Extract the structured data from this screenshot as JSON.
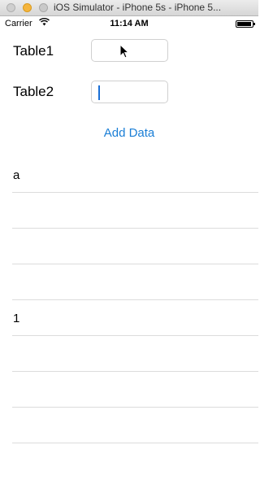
{
  "window": {
    "title": "iOS Simulator - iPhone 5s - iPhone 5..."
  },
  "status_bar": {
    "carrier": "Carrier",
    "time": "11:14 AM"
  },
  "form": {
    "table1_label": "Table1",
    "table1_value": "",
    "table2_label": "Table2",
    "table2_value": "",
    "add_button_label": "Add Data"
  },
  "table": {
    "rows": [
      "a",
      "",
      "",
      "",
      "1",
      "",
      "",
      ""
    ]
  }
}
